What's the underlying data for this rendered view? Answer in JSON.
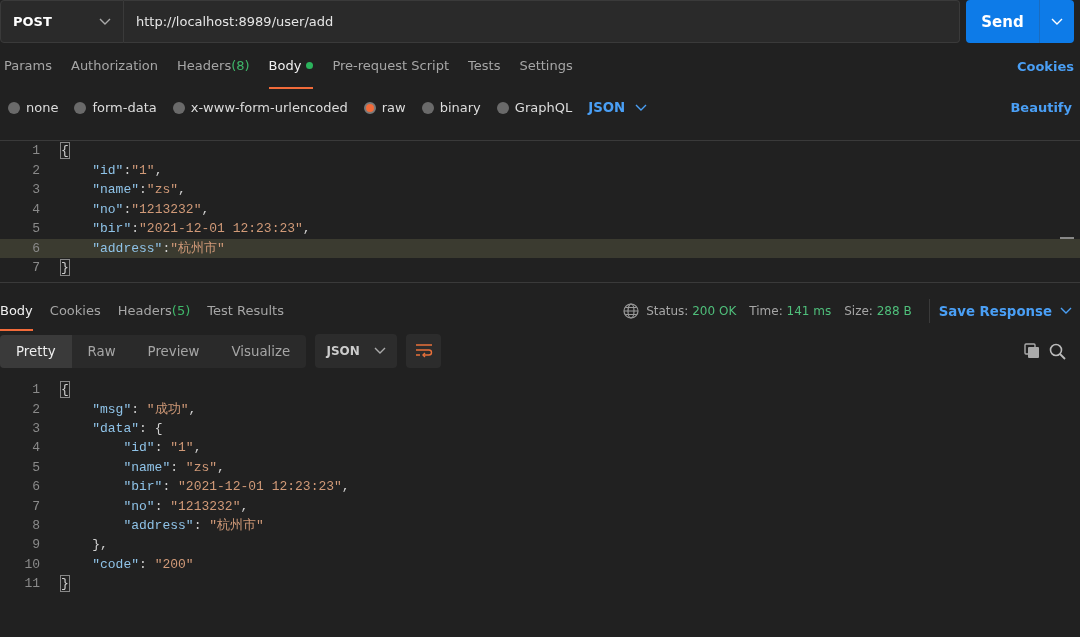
{
  "request": {
    "method": "POST",
    "url": "http://localhost:8989/user/add",
    "send_label": "Send"
  },
  "request_tabs": [
    {
      "label": "Params",
      "selected": false
    },
    {
      "label": "Authorization",
      "selected": false
    },
    {
      "label": "Headers",
      "count": "(8)",
      "selected": false
    },
    {
      "label": "Body",
      "selected": true,
      "indicator": true
    },
    {
      "label": "Pre-request Script",
      "selected": false
    },
    {
      "label": "Tests",
      "selected": false
    },
    {
      "label": "Settings",
      "selected": false
    }
  ],
  "cookies_link": "Cookies",
  "body_types": [
    {
      "label": "none",
      "selected": false
    },
    {
      "label": "form-data",
      "selected": false
    },
    {
      "label": "x-www-form-urlencoded",
      "selected": false
    },
    {
      "label": "raw",
      "selected": true
    },
    {
      "label": "binary",
      "selected": false
    },
    {
      "label": "GraphQL",
      "selected": false
    }
  ],
  "body_format": "JSON",
  "beautify_link": "Beautify",
  "request_body": {
    "lines": [
      {
        "number": "1",
        "tokens": [
          {
            "kind": "open",
            "text": "{",
            "matched": true
          }
        ]
      },
      {
        "number": "2",
        "tokens": [
          {
            "kind": "key",
            "text": "\"id\""
          },
          {
            "kind": "punct",
            "text": ":"
          },
          {
            "kind": "string",
            "text": "\"1\""
          },
          {
            "kind": "punct",
            "text": ","
          }
        ]
      },
      {
        "number": "3",
        "tokens": [
          {
            "kind": "key",
            "text": "\"name\""
          },
          {
            "kind": "punct",
            "text": ":"
          },
          {
            "kind": "string",
            "text": "\"zs\""
          },
          {
            "kind": "punct",
            "text": ","
          }
        ]
      },
      {
        "number": "4",
        "tokens": [
          {
            "kind": "key",
            "text": "\"no\""
          },
          {
            "kind": "punct",
            "text": ":"
          },
          {
            "kind": "string",
            "text": "\"1213232\""
          },
          {
            "kind": "punct",
            "text": ","
          }
        ]
      },
      {
        "number": "5",
        "tokens": [
          {
            "kind": "key",
            "text": "\"bir\""
          },
          {
            "kind": "punct",
            "text": ":"
          },
          {
            "kind": "string",
            "text": "\"2021-12-01 12:23:23\""
          },
          {
            "kind": "punct",
            "text": ","
          }
        ]
      },
      {
        "number": "6",
        "highlighted": true,
        "tokens": [
          {
            "kind": "key",
            "text": "\"address\""
          },
          {
            "kind": "punct",
            "text": ":"
          },
          {
            "kind": "string",
            "text": "\"杭州市\""
          }
        ]
      },
      {
        "number": "7",
        "tokens": [
          {
            "kind": "close",
            "text": "}",
            "matched": true
          }
        ]
      }
    ]
  },
  "response_tabs": [
    {
      "label": "Body",
      "selected": true
    },
    {
      "label": "Cookies",
      "selected": false
    },
    {
      "label": "Headers",
      "count": "(5)",
      "selected": false
    },
    {
      "label": "Test Results",
      "selected": false
    }
  ],
  "response_meta": [
    {
      "label": "Status:",
      "value": "200 OK"
    },
    {
      "label": "Time:",
      "value": "141 ms"
    },
    {
      "label": "Size:",
      "value": "288 B"
    }
  ],
  "save_response": "Save Response",
  "view_modes": [
    {
      "label": "Pretty",
      "selected": true
    },
    {
      "label": "Raw",
      "selected": false
    },
    {
      "label": "Preview",
      "selected": false
    },
    {
      "label": "Visualize",
      "selected": false
    }
  ],
  "response_format": "JSON",
  "response_body": {
    "lines": [
      {
        "number": "1",
        "tokens": [
          {
            "kind": "open",
            "text": "{",
            "matched": true
          }
        ]
      },
      {
        "number": "2",
        "tokens": [
          {
            "kind": "key",
            "text": "\"msg\""
          },
          {
            "kind": "punct",
            "text": ": "
          },
          {
            "kind": "string",
            "text": "\"成功\""
          },
          {
            "kind": "punct",
            "text": ","
          }
        ]
      },
      {
        "number": "3",
        "tokens": [
          {
            "kind": "key",
            "text": "\"data\""
          },
          {
            "kind": "punct",
            "text": ": "
          },
          {
            "kind": "open",
            "text": "{"
          }
        ]
      },
      {
        "number": "4",
        "tokens": [
          {
            "kind": "key",
            "text": "\"id\""
          },
          {
            "kind": "punct",
            "text": ": "
          },
          {
            "kind": "string",
            "text": "\"1\""
          },
          {
            "kind": "punct",
            "text": ","
          }
        ]
      },
      {
        "number": "5",
        "tokens": [
          {
            "kind": "key",
            "text": "\"name\""
          },
          {
            "kind": "punct",
            "text": ": "
          },
          {
            "kind": "string",
            "text": "\"zs\""
          },
          {
            "kind": "punct",
            "text": ","
          }
        ]
      },
      {
        "number": "6",
        "tokens": [
          {
            "kind": "key",
            "text": "\"bir\""
          },
          {
            "kind": "punct",
            "text": ": "
          },
          {
            "kind": "string",
            "text": "\"2021-12-01 12:23:23\""
          },
          {
            "kind": "punct",
            "text": ","
          }
        ]
      },
      {
        "number": "7",
        "tokens": [
          {
            "kind": "key",
            "text": "\"no\""
          },
          {
            "kind": "punct",
            "text": ": "
          },
          {
            "kind": "string",
            "text": "\"1213232\""
          },
          {
            "kind": "punct",
            "text": ","
          }
        ]
      },
      {
        "number": "8",
        "tokens": [
          {
            "kind": "key",
            "text": "\"address\""
          },
          {
            "kind": "punct",
            "text": ": "
          },
          {
            "kind": "string",
            "text": "\"杭州市\""
          }
        ]
      },
      {
        "number": "9",
        "tokens": [
          {
            "kind": "close",
            "text": "}"
          },
          {
            "kind": "punct",
            "text": ","
          }
        ]
      },
      {
        "number": "10",
        "tokens": [
          {
            "kind": "key",
            "text": "\"code\""
          },
          {
            "kind": "punct",
            "text": ": "
          },
          {
            "kind": "string",
            "text": "\"200\""
          }
        ]
      },
      {
        "number": "11",
        "tokens": [
          {
            "kind": "close",
            "text": "}",
            "matched": true
          }
        ]
      }
    ]
  }
}
